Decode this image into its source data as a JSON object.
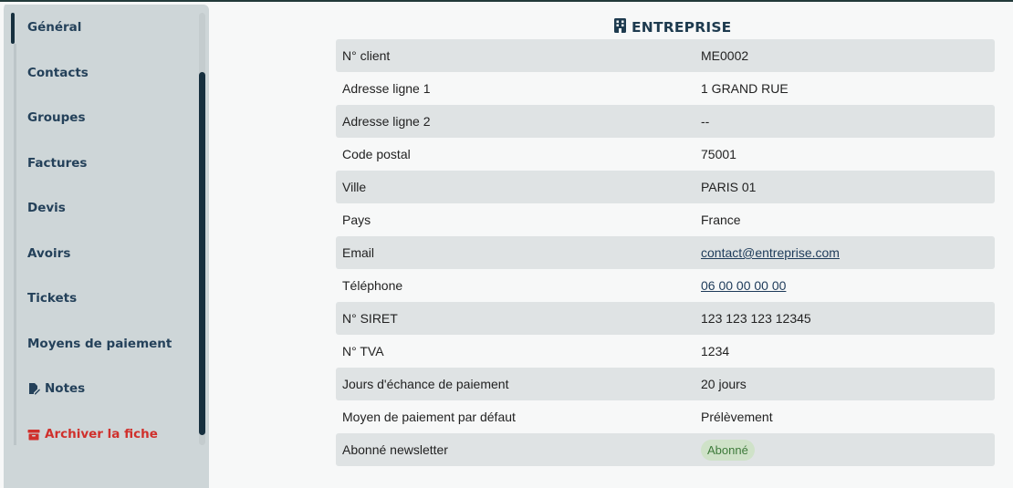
{
  "sidebar": {
    "items": [
      {
        "label": "Général"
      },
      {
        "label": "Contacts"
      },
      {
        "label": "Groupes"
      },
      {
        "label": "Factures"
      },
      {
        "label": "Devis"
      },
      {
        "label": "Avoirs"
      },
      {
        "label": "Tickets"
      },
      {
        "label": "Moyens de paiement"
      },
      {
        "label": "Notes"
      },
      {
        "label": "Archiver la fiche"
      }
    ]
  },
  "company": {
    "title": "ENTREPRISE",
    "rows": [
      {
        "label": "N° client",
        "value": "ME0002"
      },
      {
        "label": "Adresse ligne 1",
        "value": "1 GRAND RUE"
      },
      {
        "label": "Adresse ligne 2",
        "value": "--"
      },
      {
        "label": "Code postal",
        "value": "75001"
      },
      {
        "label": "Ville",
        "value": "PARIS 01"
      },
      {
        "label": "Pays",
        "value": "France"
      },
      {
        "label": "Email",
        "value": "contact@entreprise.com"
      },
      {
        "label": "Téléphone",
        "value": "06 00 00 00 00"
      },
      {
        "label": "N° SIRET",
        "value": "123 123 123 12345"
      },
      {
        "label": "N° TVA",
        "value": "1234"
      },
      {
        "label": "Jours d'échance de paiement",
        "value": "20 jours"
      },
      {
        "label": "Moyen de paiement par défaut",
        "value": "Prélèvement"
      },
      {
        "label": "Abonné newsletter",
        "value": "Abonné"
      }
    ]
  },
  "colors": {
    "accent": "#17303f",
    "danger": "#d0302c",
    "badge_bg": "#cfe2c8",
    "badge_text": "#3d7a3a"
  }
}
